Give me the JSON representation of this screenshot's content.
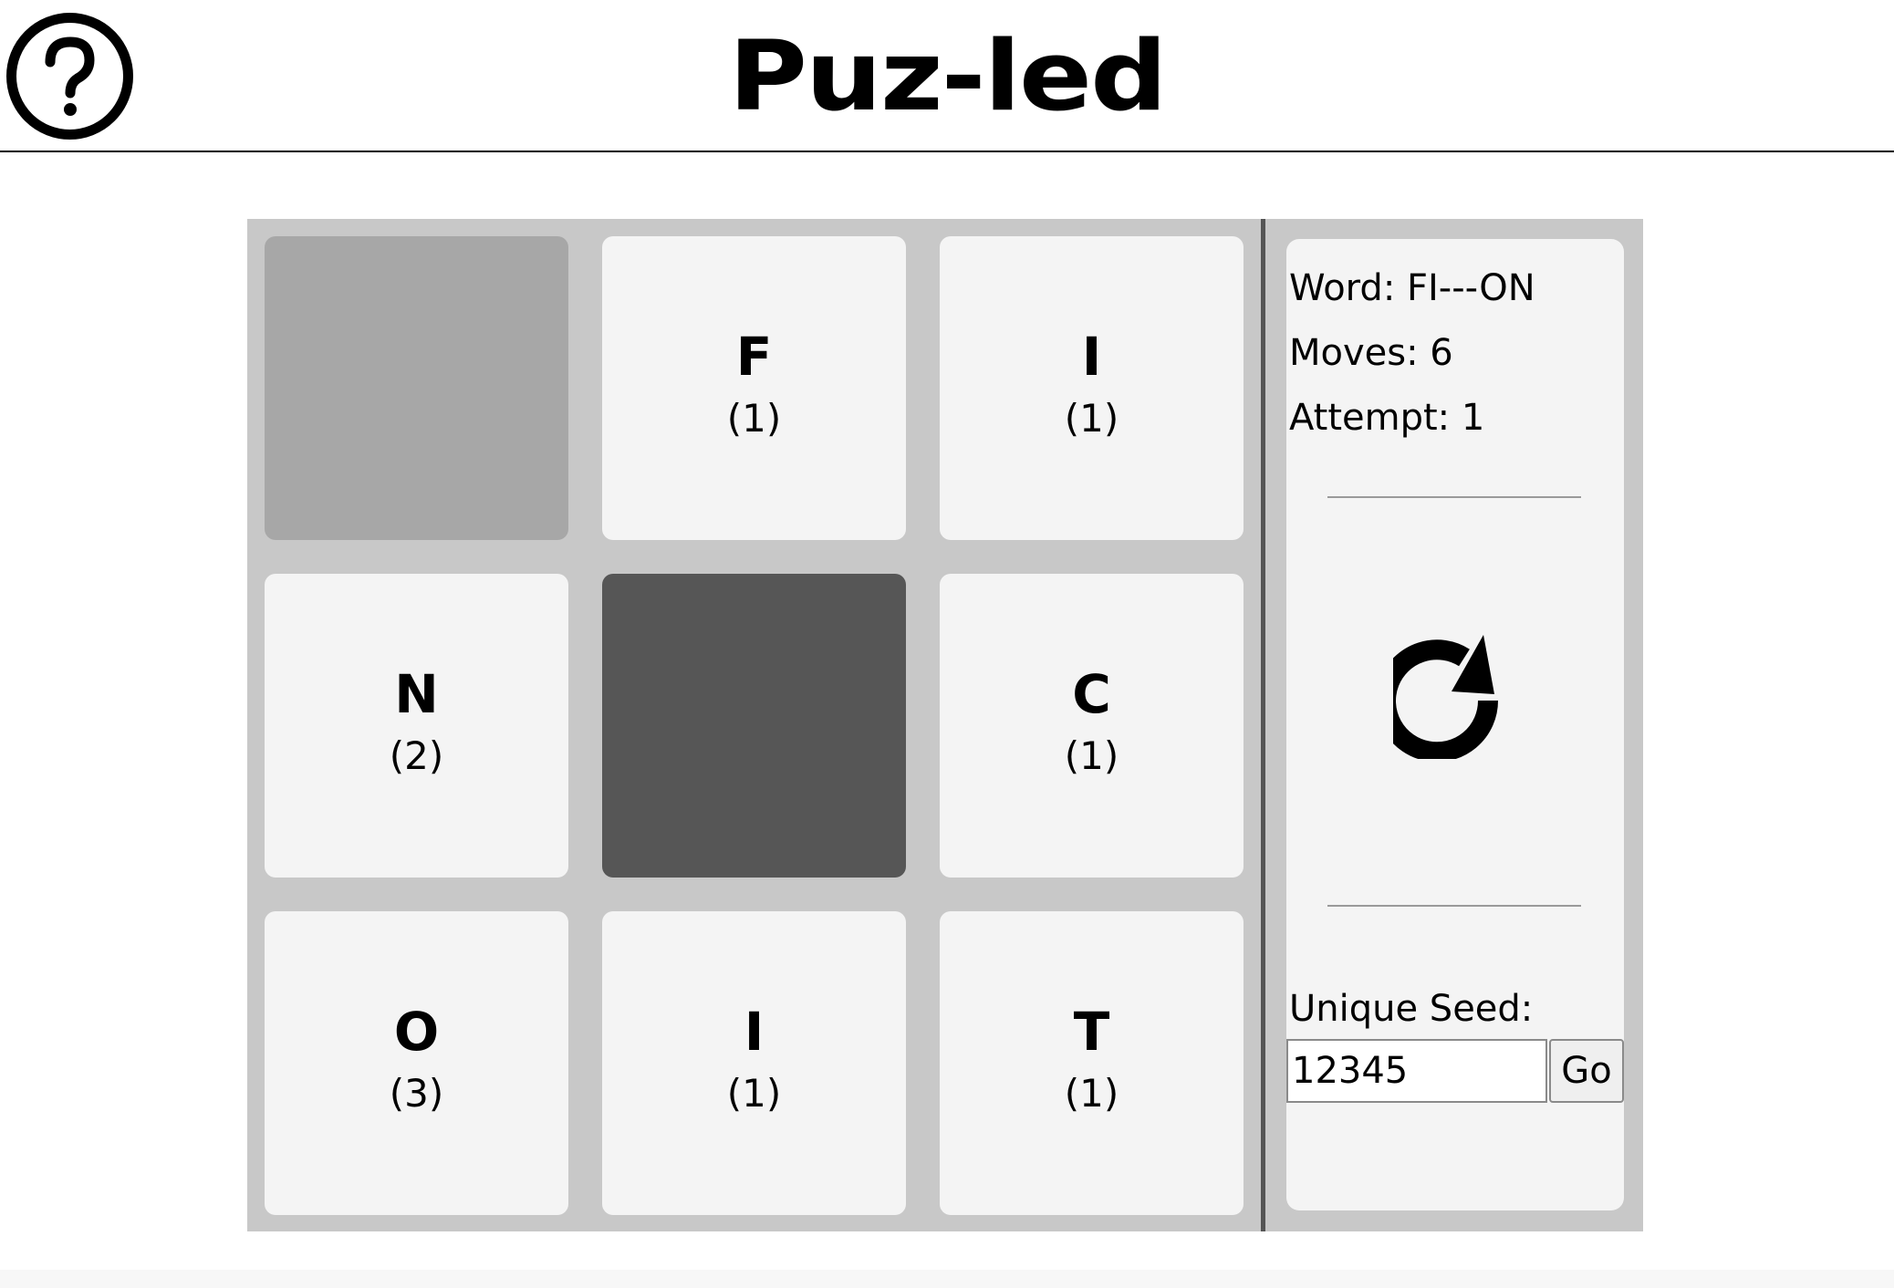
{
  "header": {
    "title": "Puz-led",
    "help_icon": "question-circle-icon"
  },
  "board": {
    "tiles": [
      {
        "letter": "",
        "count": "",
        "state": "empty"
      },
      {
        "letter": "F",
        "count": "(1)",
        "state": "normal"
      },
      {
        "letter": "I",
        "count": "(1)",
        "state": "normal"
      },
      {
        "letter": "N",
        "count": "(2)",
        "state": "normal"
      },
      {
        "letter": "",
        "count": "",
        "state": "selected"
      },
      {
        "letter": "C",
        "count": "(1)",
        "state": "normal"
      },
      {
        "letter": "O",
        "count": "(3)",
        "state": "normal"
      },
      {
        "letter": "I",
        "count": "(1)",
        "state": "normal"
      },
      {
        "letter": "T",
        "count": "(1)",
        "state": "normal"
      }
    ]
  },
  "panel": {
    "word": "Word: FI---ON",
    "moves": "Moves: 6",
    "attempt": "Attempt: 1",
    "reset_icon": "reset-arrow-icon",
    "seed_label": "Unique Seed:",
    "seed_value": "12345",
    "go_label": "Go"
  },
  "colors": {
    "board_bg": "#c8c8c8",
    "tile": "#f4f4f4",
    "tile_empty": "#a7a7a7",
    "tile_selected": "#565656",
    "divider": "#555555"
  }
}
